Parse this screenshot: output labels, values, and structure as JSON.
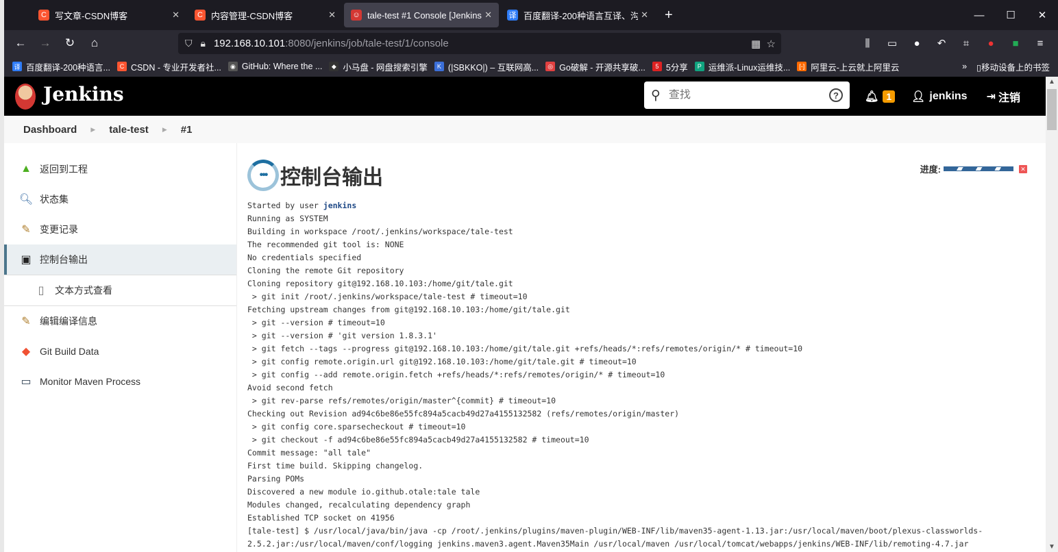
{
  "browser": {
    "tabs": [
      {
        "title": "写文章-CSDN博客",
        "icon": "csdn-icon",
        "color": "#fc5531",
        "active": false
      },
      {
        "title": "内容管理-CSDN博客",
        "icon": "csdn-icon",
        "color": "#fc5531",
        "active": false
      },
      {
        "title": "tale-test #1 Console [Jenkins]",
        "icon": "jenkins-icon",
        "color": "#d33833",
        "active": true
      },
      {
        "title": "百度翻译-200种语言互译、沟通",
        "icon": "baidu-translate-icon",
        "color": "#2f7cf6",
        "active": false
      }
    ],
    "url_host": "192.168.10.101",
    "url_path": ":8080/jenkins/job/tale-test/1/console",
    "bookmarks": [
      {
        "label": "百度翻译-200种语言...",
        "color": "#2f7cf6",
        "g": "译"
      },
      {
        "label": "CSDN - 专业开发者社...",
        "color": "#fc5531",
        "g": "C"
      },
      {
        "label": "GitHub: Where the ...",
        "color": "#555",
        "g": "◉"
      },
      {
        "label": "小马盘 - 网盘搜索引擎",
        "color": "#333",
        "g": "◆"
      },
      {
        "label": "(|SBKKO|) – 互联网高...",
        "color": "#3b6fd8",
        "g": "K"
      },
      {
        "label": "Go破解 - 开源共享破...",
        "color": "#e04040",
        "g": "◎"
      },
      {
        "label": "5分享",
        "color": "#d22",
        "g": "5"
      },
      {
        "label": "运维派-Linux运维技...",
        "color": "#10a37f",
        "g": "P"
      },
      {
        "label": "阿里云-上云就上阿里云",
        "color": "#ff6a00",
        "g": "[-]"
      }
    ],
    "mobile_bookmarks": "移动设备上的书签"
  },
  "header": {
    "brand": "Jenkins",
    "search_placeholder": "查找",
    "notifications": "1",
    "user": "jenkins",
    "logout": "注销"
  },
  "breadcrumb": [
    "Dashboard",
    "tale-test",
    "#1"
  ],
  "sidebar": [
    {
      "label": "返回到工程",
      "icon": "up-arrow-icon"
    },
    {
      "label": "状态集",
      "icon": "magnifier-icon"
    },
    {
      "label": "变更记录",
      "icon": "notepad-icon"
    },
    {
      "label": "控制台输出",
      "icon": "terminal-icon",
      "active": true
    },
    {
      "label": "文本方式查看",
      "icon": "document-icon",
      "sub": true
    },
    {
      "label": "编辑编译信息",
      "icon": "notepad-icon"
    },
    {
      "label": "Git Build Data",
      "icon": "git-icon"
    },
    {
      "label": "Monitor Maven Process",
      "icon": "computer-icon"
    }
  ],
  "main": {
    "title": "控制台输出",
    "progress_label": "进度:",
    "started_by": "Started by user ",
    "started_user": "jenkins",
    "log": [
      "Running as SYSTEM",
      "Building in workspace /root/.jenkins/workspace/tale-test",
      "The recommended git tool is: NONE",
      "No credentials specified",
      "Cloning the remote Git repository",
      "Cloning repository git@192.168.10.103:/home/git/tale.git",
      " > git init /root/.jenkins/workspace/tale-test # timeout=10",
      "Fetching upstream changes from git@192.168.10.103:/home/git/tale.git",
      " > git --version # timeout=10",
      " > git --version # 'git version 1.8.3.1'",
      " > git fetch --tags --progress git@192.168.10.103:/home/git/tale.git +refs/heads/*:refs/remotes/origin/* # timeout=10",
      " > git config remote.origin.url git@192.168.10.103:/home/git/tale.git # timeout=10",
      " > git config --add remote.origin.fetch +refs/heads/*:refs/remotes/origin/* # timeout=10",
      "Avoid second fetch",
      " > git rev-parse refs/remotes/origin/master^{commit} # timeout=10",
      "Checking out Revision ad94c6be86e55fc894a5cacb49d27a4155132582 (refs/remotes/origin/master)",
      " > git config core.sparsecheckout # timeout=10",
      " > git checkout -f ad94c6be86e55fc894a5cacb49d27a4155132582 # timeout=10",
      "Commit message: \"all tale\"",
      "First time build. Skipping changelog.",
      "Parsing POMs",
      "Discovered a new module io.github.otale:tale tale",
      "Modules changed, recalculating dependency graph",
      "Established TCP socket on 41956",
      "[tale-test] $ /usr/local/java/bin/java -cp /root/.jenkins/plugins/maven-plugin/WEB-INF/lib/maven35-agent-1.13.jar:/usr/local/maven/boot/plexus-classworlds-",
      "2.5.2.jar:/usr/local/maven/conf/logging jenkins.maven3.agent.Maven35Main /usr/local/maven /usr/local/tomcat/webapps/jenkins/WEB-INF/lib/remoting-4.7.jar"
    ]
  }
}
